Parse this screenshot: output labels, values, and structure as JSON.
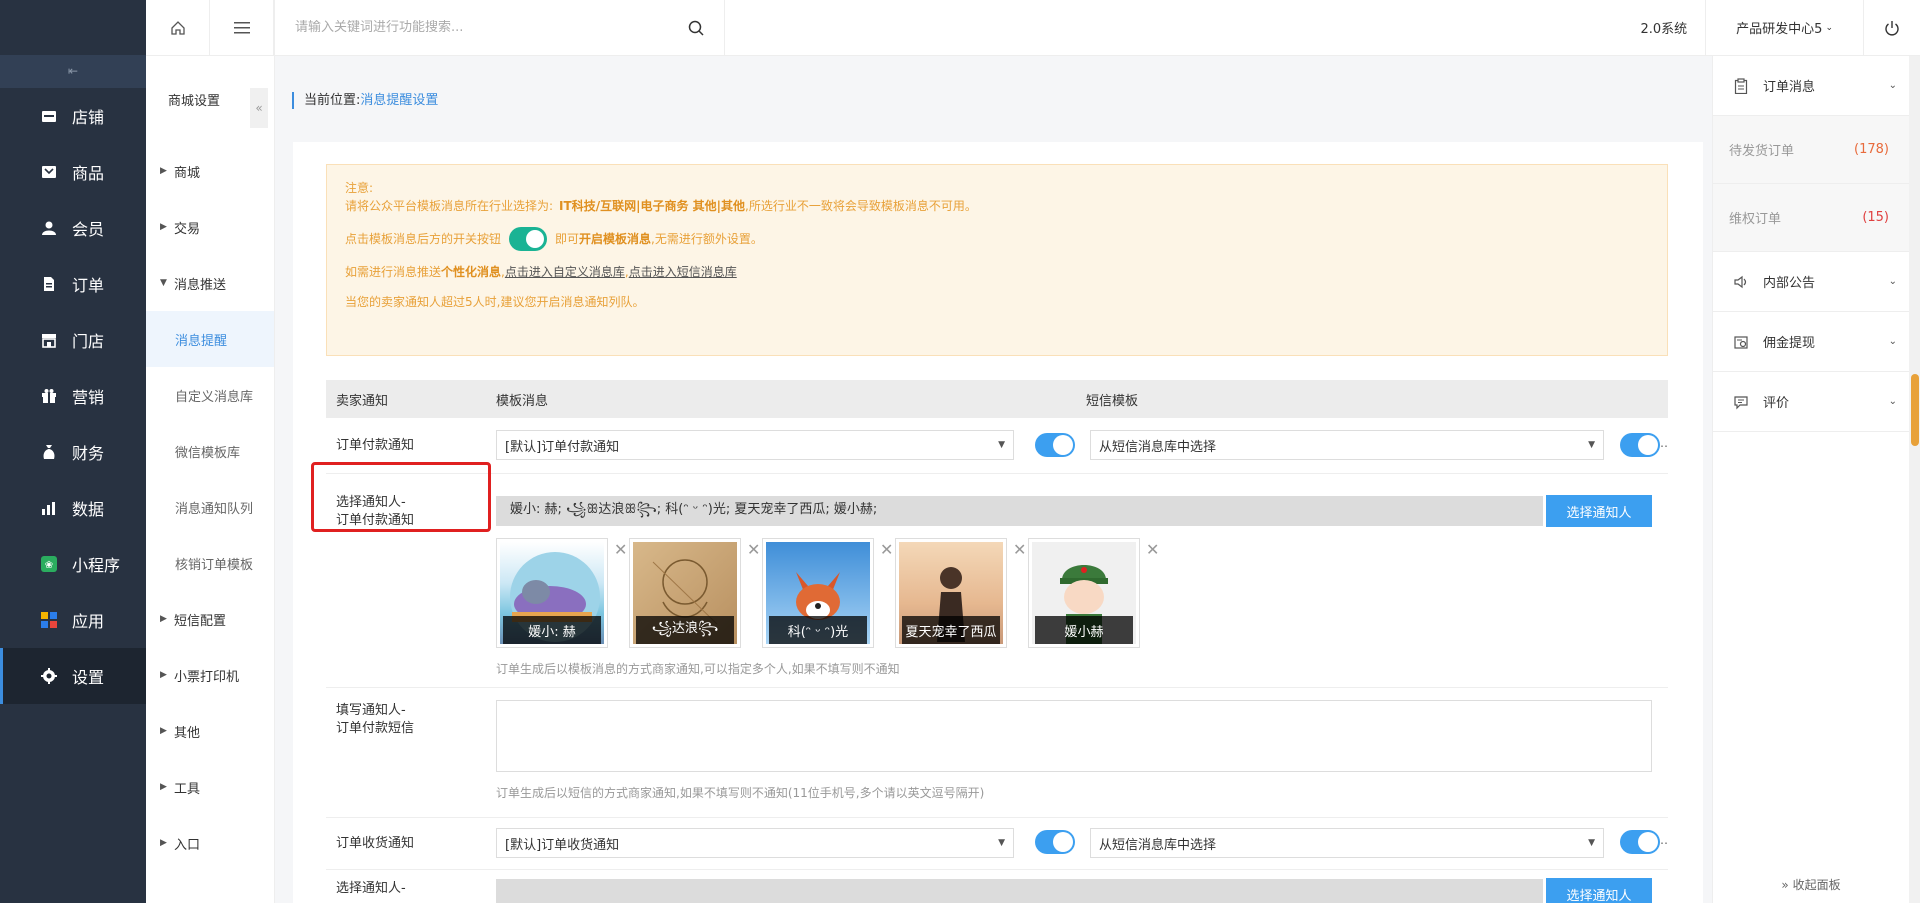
{
  "sidebar": {
    "items": [
      {
        "label": "店铺",
        "icon": "store-icon"
      },
      {
        "label": "商品",
        "icon": "goods-icon"
      },
      {
        "label": "会员",
        "icon": "member-icon"
      },
      {
        "label": "订单",
        "icon": "order-icon"
      },
      {
        "label": "门店",
        "icon": "shop-icon"
      },
      {
        "label": "营销",
        "icon": "gift-icon"
      },
      {
        "label": "财务",
        "icon": "finance-icon"
      },
      {
        "label": "数据",
        "icon": "chart-icon"
      },
      {
        "label": "小程序",
        "icon": "miniapp-icon"
      },
      {
        "label": "应用",
        "icon": "apps-icon"
      },
      {
        "label": "设置",
        "icon": "gear-icon"
      }
    ]
  },
  "subnav": {
    "title": "商城设置",
    "items": [
      {
        "label": "商城"
      },
      {
        "label": "交易"
      },
      {
        "label": "消息推送"
      },
      {
        "label": "消息提醒"
      },
      {
        "label": "自定义消息库"
      },
      {
        "label": "微信模板库"
      },
      {
        "label": "消息通知队列"
      },
      {
        "label": "核销订单模板"
      },
      {
        "label": "短信配置"
      },
      {
        "label": "小票打印机"
      },
      {
        "label": "其他"
      },
      {
        "label": "工具"
      },
      {
        "label": "入口"
      }
    ]
  },
  "topbar": {
    "search_placeholder": "请输入关键词进行功能搜索...",
    "system": "2.0系统",
    "org": "产品研发中心5"
  },
  "breadcrumb": {
    "prefix": "当前位置:",
    "current": "消息提醒设置"
  },
  "notice": {
    "title": "注意:",
    "line1_a": "请将公众平台模板消息所在行业选择为:",
    "line1_b": "IT科技/互联网|电子商务 其他|其他",
    "line1_c": ",所选行业不一致将会导致模板消息不可用。",
    "line2_a": "点击模板消息后方的开关按钮",
    "line2_b": "即可",
    "line2_c": "开启模板消息",
    "line2_d": ",无需进行额外设置。",
    "line3_a": "如需进行消息推送",
    "line3_b": "个性化消息",
    "line3_c": ",",
    "line3_link1": "点击进入自定义消息库",
    "line3_sep": ",",
    "line3_link2": "点击进入短信消息库",
    "line4": "当您的卖家通知人超过5人时,建议您开启消息通知列队。"
  },
  "table": {
    "col1": "卖家通知",
    "col2": "模板消息",
    "col3": "短信模板"
  },
  "rows": {
    "pay": {
      "label": "订单付款通知",
      "template": "[默认]订单付款通知",
      "sms": "从短信消息库中选择"
    },
    "pay_people": {
      "label1": "选择通知人-",
      "label2": "订单付款通知",
      "names": "媛小: 赫; ꧁ꕥ达浪ꕥ꧂; 科(ᵔ ᵕ ᵔ)光; 夏天宠幸了西瓜; 媛小赫;",
      "button": "选择通知人",
      "avatars": [
        "媛小: 赫",
        "꧁达浪꧂",
        "科(ᵔ ᵕ ᵔ)光",
        "夏天宠幸了西瓜",
        "媛小赫"
      ],
      "hint": "订单生成后以模板消息的方式商家通知,可以指定多个人,如果不填写则不通知"
    },
    "pay_sms": {
      "label1": "填写通知人-",
      "label2": "订单付款短信",
      "hint": "订单生成后以短信的方式商家通知,如果不填写则不通知(11位手机号,多个请以英文逗号隔开)"
    },
    "receive": {
      "label": "订单收货通知",
      "template": "[默认]订单收货通知",
      "sms": "从短信消息库中选择"
    },
    "receive_people": {
      "label1": "选择通知人-",
      "button": "选择通知人"
    }
  },
  "rpanel": {
    "order_msg": "订单消息",
    "pending": "待发货订单",
    "pending_count": "(178)",
    "rights": "维权订单",
    "rights_count": "(15)",
    "notice": "内部公告",
    "commission": "佣金提现",
    "review": "评价",
    "collapse": "» 收起面板"
  },
  "colors": {
    "accent": "#3c9ff0",
    "sidebar_bg": "#283241",
    "notice_text": "#e8a139",
    "highlight_box": "#e02020"
  }
}
